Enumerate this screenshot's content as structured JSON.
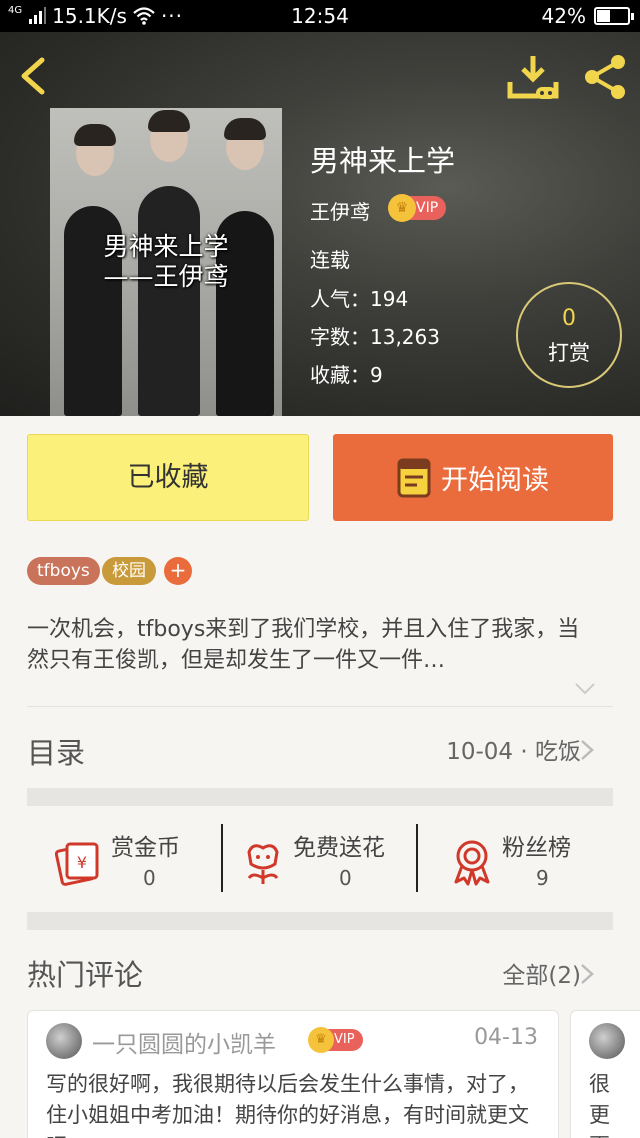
{
  "status_bar": {
    "network": "4G",
    "speed": "15.1K/s",
    "more": "···",
    "time": "12:54",
    "battery": "42%",
    "battery_level": 0.42
  },
  "book": {
    "cover_title_line1": "男神来上学",
    "cover_title_line2": "——王伊鸢",
    "title": "男神来上学",
    "author": "王伊鸢",
    "vip": "VIP",
    "status": "连载",
    "popularity": "人气：194",
    "word_count": "字数：13,263",
    "favorites": "收藏：9",
    "reward_count": "0",
    "reward_label": "打赏"
  },
  "actions": {
    "collected_label": "已收藏",
    "read_label": "开始阅读"
  },
  "tags": [
    {
      "label": "tfboys",
      "color": "#c9735a"
    },
    {
      "label": "校园",
      "color": "#c99a3a"
    }
  ],
  "tag_add": "+",
  "description": "一次机会，tfboys来到了我们学校，并且入住了我家，当然只有王俊凯，但是却发生了一件又一件…",
  "toc": {
    "title": "目录",
    "latest": "10-04 · 吃饭"
  },
  "stats": [
    {
      "icon": "red-envelope-icon",
      "label": "赏金币",
      "value": "0"
    },
    {
      "icon": "flower-icon",
      "label": "免费送花",
      "value": "0"
    },
    {
      "icon": "medal-icon",
      "label": "粉丝榜",
      "value": "9"
    }
  ],
  "comments": {
    "title": "热门评论",
    "all_label": "全部(2)",
    "items": [
      {
        "user": "一只圆圆的小凯羊",
        "vip": "VIP",
        "date": "04-13",
        "body": "写的很好啊，我很期待以后会发生什么事情，对了，住小姐姐中考加油！期待你的好消息，有时间就更文吧"
      },
      {
        "body": "很更更"
      }
    ]
  },
  "colors": {
    "accent_orange": "#ea6b3c",
    "collect_yellow": "#fbf07a",
    "icon_yellow": "#f0d54d",
    "icon_red": "#d0382a"
  }
}
